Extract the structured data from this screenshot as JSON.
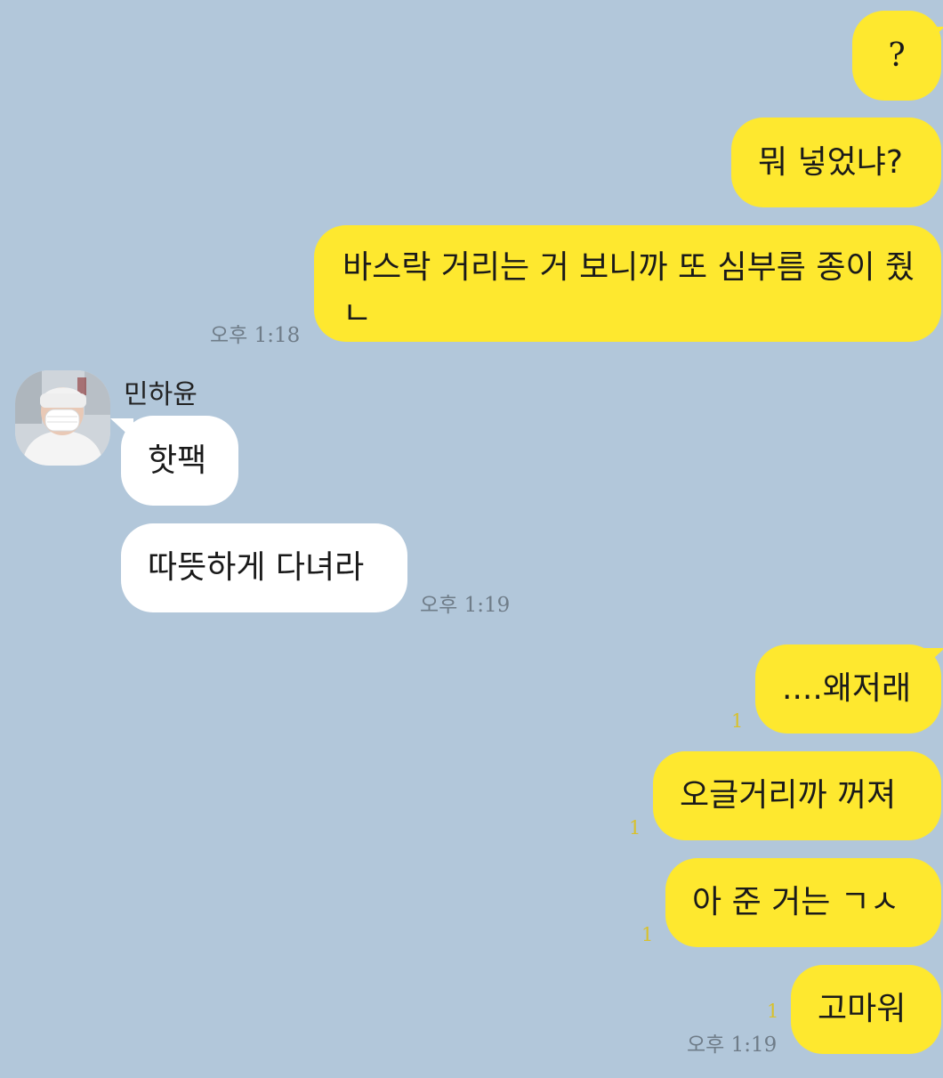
{
  "contact": {
    "name": "민하윤",
    "avatar_icon": "profile-photo"
  },
  "messages": {
    "m1": "?",
    "m2": "뭐 넣었냐?",
    "m3": "바스락 거리는 거 보니까 또 심부름 종이 줬ㄴ",
    "m4": "핫팩",
    "m5": "따뜻하게 다녀라",
    "m6": "....왜저래",
    "m7": "오글거리까 꺼져",
    "m8": "아 준 거는 ㄱㅅ",
    "m9": "고마워"
  },
  "times": {
    "t1": "오후 1:18",
    "t2": "오후 1:19",
    "t3": "오후 1:19"
  },
  "unread": {
    "u6": "1",
    "u7": "1",
    "u8": "1",
    "u9": "1"
  },
  "colors": {
    "background": "#b2c7da",
    "sent_bubble": "#fee82f",
    "received_bubble": "#ffffff",
    "unread_count": "#d9c12a"
  }
}
